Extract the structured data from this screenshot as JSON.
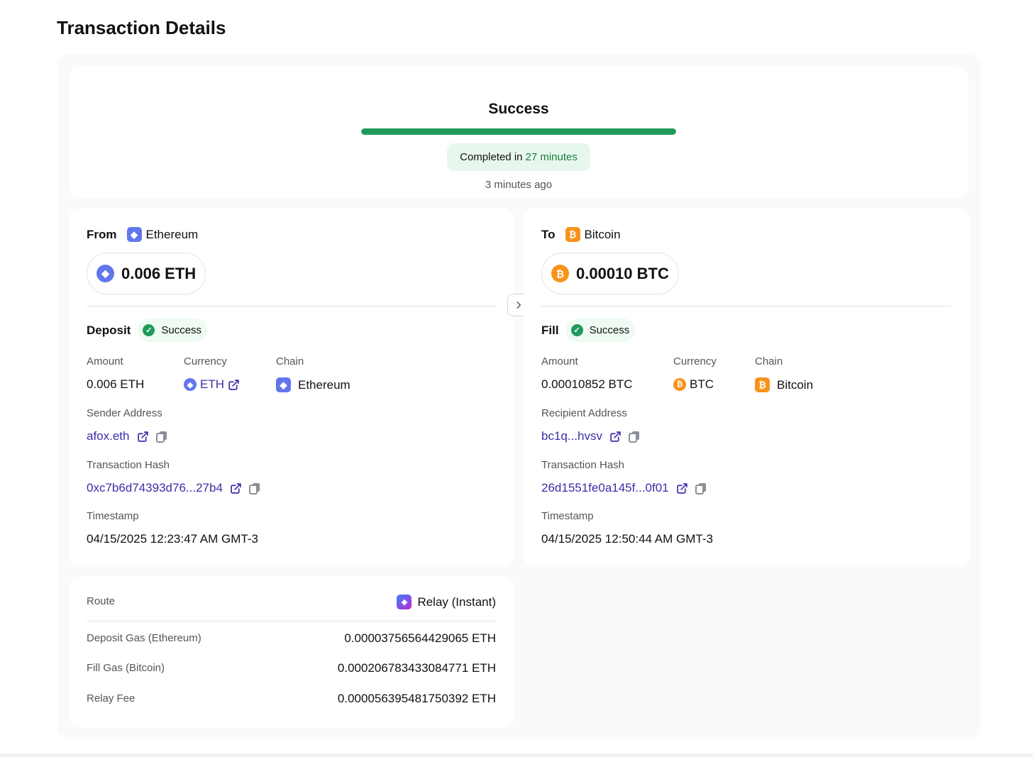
{
  "page": {
    "title": "Transaction Details"
  },
  "status": {
    "title": "Success",
    "progress_fraction": 1.0,
    "progress_color": "#1f9a5b",
    "completed_prefix": "Completed in",
    "completed_duration": "27 minutes",
    "time_ago": "3 minutes ago"
  },
  "from": {
    "label": "From",
    "chain_icon": "ethereum-icon",
    "chain_name": "Ethereum",
    "amount": "0.006 ETH",
    "stage_label": "Deposit",
    "stage_status": "Success",
    "amount_label": "Amount",
    "amount_value": "0.006 ETH",
    "currency_label": "Currency",
    "currency_value": "ETH",
    "chain_label": "Chain",
    "chain_value": "Ethereum",
    "address_label": "Sender Address",
    "address_value": "afox.eth",
    "hash_label": "Transaction Hash",
    "hash_value": "0xc7b6d74393d76...27b4",
    "timestamp_label": "Timestamp",
    "timestamp_value": "04/15/2025 12:23:47 AM GMT-3"
  },
  "to": {
    "label": "To",
    "chain_icon": "bitcoin-icon",
    "chain_name": "Bitcoin",
    "amount": "0.00010 BTC",
    "stage_label": "Fill",
    "stage_status": "Success",
    "amount_label": "Amount",
    "amount_value": "0.00010852 BTC",
    "currency_label": "Currency",
    "currency_value": "BTC",
    "chain_label": "Chain",
    "chain_value": "Bitcoin",
    "address_label": "Recipient Address",
    "address_value": "bc1q...hvsv",
    "hash_label": "Transaction Hash",
    "hash_value": "26d1551fe0a145f...0f01",
    "timestamp_label": "Timestamp",
    "timestamp_value": "04/15/2025 12:50:44 AM GMT-3"
  },
  "fees": {
    "route_label": "Route",
    "route_value": "Relay (Instant)",
    "deposit_gas_label": "Deposit Gas (Ethereum)",
    "deposit_gas_value": "0.00003756564429065 ETH",
    "fill_gas_label": "Fill Gas (Bitcoin)",
    "fill_gas_value": "0.000206783433084771 ETH",
    "relay_fee_label": "Relay Fee",
    "relay_fee_value": "0.000056395481750392 ETH"
  },
  "colors": {
    "eth": "#6276ec",
    "btc": "#f7931a",
    "success": "#1f9a5b",
    "link": "#3a2fa8"
  },
  "icons": {
    "eth_glyph": "◆",
    "btc_glyph": "₿",
    "check_glyph": "✓",
    "relay_glyph": "◈"
  }
}
